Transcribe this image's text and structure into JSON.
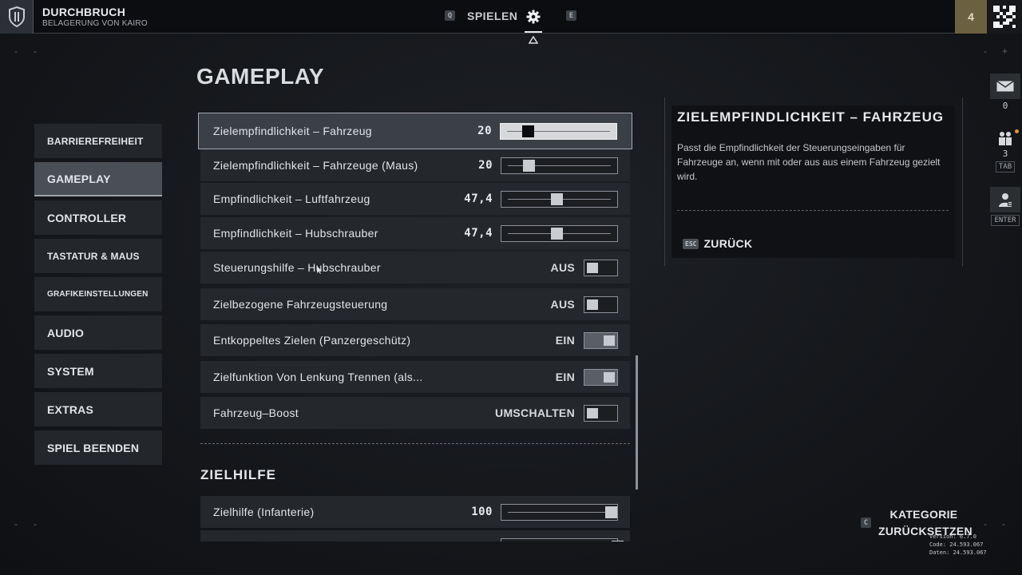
{
  "header": {
    "mode_title": "DURCHBRUCH",
    "mode_subtitle": "BELAGERUNG VON KAIRO",
    "nav_left_key": "Q",
    "nav_play_label": "SPIELEN",
    "nav_right_key": "E",
    "level": "4",
    "emblem_icon": "shield-icon",
    "settings_icon": "gear-icon",
    "profile_icon": "qr-code-icon"
  },
  "page": {
    "title": "GAMEPLAY"
  },
  "sidebar": {
    "items": [
      {
        "label": "BARRIEREFREIHEIT",
        "active": false
      },
      {
        "label": "GAMEPLAY",
        "active": true
      },
      {
        "label": "CONTROLLER",
        "active": false
      },
      {
        "label": "TASTATUR & MAUS",
        "active": false
      },
      {
        "label": "GRAFIKEINSTELLUNGEN",
        "active": false
      },
      {
        "label": "AUDIO",
        "active": false
      },
      {
        "label": "SYSTEM",
        "active": false
      },
      {
        "label": "EXTRAS",
        "active": false
      },
      {
        "label": "SPIEL BEENDEN",
        "active": false
      }
    ]
  },
  "settings": {
    "rows": [
      {
        "label": "Zielempfindlichkeit – Fahrzeug",
        "type": "slider",
        "value": "20",
        "fraction": 0.2,
        "selected": true
      },
      {
        "label": "Zielempfindlichkeit – Fahrzeuge (Maus)",
        "type": "slider",
        "value": "20",
        "fraction": 0.2,
        "selected": false
      },
      {
        "label": "Empfindlichkeit – Luftfahrzeug",
        "type": "slider",
        "value": "47,4",
        "fraction": 0.474,
        "selected": false
      },
      {
        "label": "Empfindlichkeit – Hubschrauber",
        "type": "slider",
        "value": "47,4",
        "fraction": 0.474,
        "selected": false
      },
      {
        "label": "Steuerungshilfe – Hubschrauber",
        "type": "toggle",
        "value": "AUS",
        "on": false,
        "selected": false
      },
      {
        "label": "Zielbezogene Fahrzeugsteuerung",
        "type": "toggle",
        "value": "AUS",
        "on": false,
        "selected": false
      },
      {
        "label": "Entkoppeltes Zielen (Panzergeschütz)",
        "type": "toggle",
        "value": "EIN",
        "on": true,
        "selected": false
      },
      {
        "label": "Zielfunktion Von Lenkung Trennen (als...",
        "type": "toggle",
        "value": "EIN",
        "on": true,
        "selected": false
      },
      {
        "label": "Fahrzeug–Boost",
        "type": "toggle",
        "value": "UMSCHALTEN",
        "on": false,
        "selected": false
      }
    ],
    "section_title": "ZIELHILFE",
    "section_rows": [
      {
        "label": "Zielhilfe (Infanterie)",
        "type": "slider",
        "value": "100",
        "fraction": 1.0,
        "selected": false
      }
    ]
  },
  "info": {
    "title": "ZIELEMPFINDLICHKEIT – FAHRZEUG",
    "description": "Passt die Empfindlichkeit der Steuerungseingaben für Fahrzeuge an, wenn mit oder aus aus einem Fahrzeug gezielt wird.",
    "back_key": "ESC",
    "back_label": "ZURÜCK"
  },
  "rail": {
    "mail_count": "0",
    "squad_count": "3",
    "squad_key": "TAB",
    "social_key": "ENTER"
  },
  "footer": {
    "reset_key": "C",
    "reset_line1": "KATEGORIE",
    "reset_line2": "ZURÜCKSETZEN",
    "version": "Version: 6.7.0",
    "code": "Code: 24.593.067",
    "date": "Daten: 24.593.067"
  },
  "colors": {
    "level_badge": "#6b6140",
    "notification_dot": "#e4933a",
    "active_tab": "#4a4e55"
  }
}
